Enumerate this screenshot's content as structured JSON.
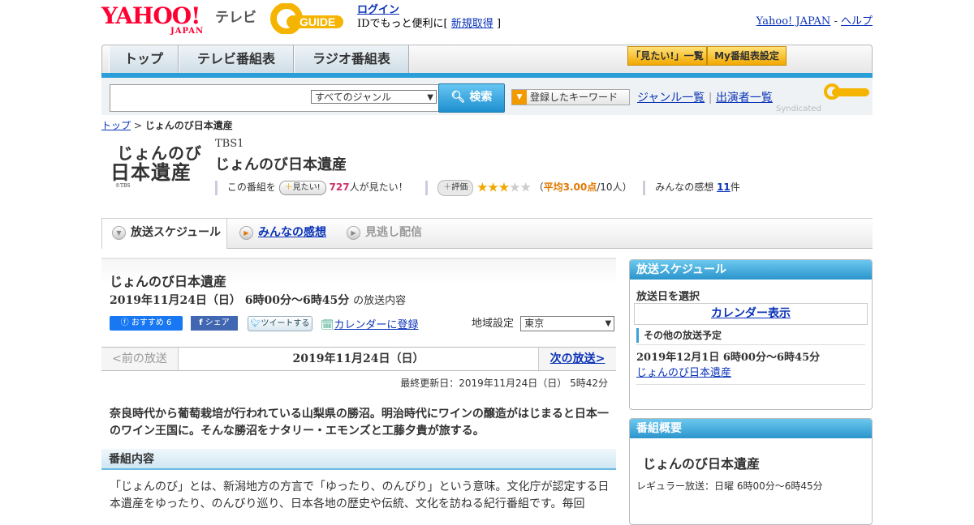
{
  "header": {
    "logo_text": "YAHOO!",
    "logo_sub": "JAPAN",
    "tv_label": "テレビ",
    "gguide_logo": "G GUIDE",
    "login_label": "ログイン",
    "login_note_prefix": "IDでもっと便利に[",
    "signup_label": "新規取得",
    "login_note_suffix": "]",
    "yahoo_japan_link": "Yahoo! JAPAN",
    "separator": "-",
    "help_link": "ヘルプ"
  },
  "nav": {
    "tabs": [
      {
        "label": "トップ"
      },
      {
        "label": "テレビ番組表"
      },
      {
        "label": "ラジオ番組表"
      }
    ],
    "want_list": "「見たい!」一覧",
    "my_schedule": "My番組表設定"
  },
  "search": {
    "genre_selected": "すべてのジャンル",
    "button_label": "検索",
    "keyword_button": "登録したキーワード",
    "genre_list": "ジャンル一覧",
    "divider": "|",
    "cast_list": "出演者一覧",
    "syndicated": "Syndicated"
  },
  "breadcrumb": {
    "top": "トップ",
    "sep": ">",
    "current": "じょんのび日本遺産"
  },
  "program": {
    "logo_line1": "じょんのび",
    "logo_line2": "日本遺産",
    "logo_copyright": "©TBS",
    "channel": "TBS1",
    "title": "じょんのび日本遺産",
    "want_prefix": "この番組を",
    "want_button": "見たい!",
    "want_count": "727",
    "want_suffix": "人が見たい！",
    "rate_button": "評価",
    "stars_on": "★★★",
    "stars_off": "★★",
    "avg_open": "（",
    "avg_label": "平均3.00点",
    "avg_people": "/10人）",
    "reviews_label": "みんなの感想",
    "reviews_count": "11",
    "reviews_suffix": "件"
  },
  "subtabs": [
    {
      "label": "放送スケジュール"
    },
    {
      "label": "みんなの感想"
    },
    {
      "label": "見逃し配信"
    }
  ],
  "main": {
    "title": "じょんのび日本遺産",
    "date": "2019年11月24日（日） 6時00分～6時45分",
    "date_suffix": "の放送内容",
    "fb_label": "おすすめ 6",
    "fb_share": "シェア",
    "tweet": "ツイートする",
    "calendar": "カレンダーに登録",
    "region_label": "地域設定",
    "region_value": "東京",
    "prev": "<前の放送",
    "current_date": "2019年11月24日（日）",
    "next": "次の放送>",
    "updated": "最終更新日：2019年11月24日（日） 5時42分",
    "description": "奈良時代から葡萄栽培が行われている山梨県の勝沼。明治時代にワインの醸造がはじまると日本一のワイン王国に。そんな勝沼をナタリー・エモンズと工藤夕貴が旅する。",
    "section_title": "番組内容",
    "section_body": "「じょんのび」とは、新潟地方の方言で「ゆったり、のんびり」という意味。文化庁が認定する日本遺産をゆったり、のんびり巡り、日本各地の歴史や伝統、文化を訪ねる紀行番組です。毎回"
  },
  "sidebar": {
    "schedule_head": "放送スケジュール",
    "select_date": "放送日を選択",
    "calendar_view": "カレンダー表示",
    "other_schedule": "その他の放送予定",
    "other_date": "2019年12月1日 6時00分～6時45分",
    "other_link": "じょんのび日本遺産",
    "overview_head": "番組概要",
    "overview_title": "じょんのび日本遺産",
    "regular": "レギュラー放送：日曜 6時00分～6時45分"
  },
  "colors": {
    "yahoo_red": "#ff0033",
    "accent_blue": "#2a9ed8",
    "link": "#0a33b8",
    "star": "#f0a800"
  }
}
